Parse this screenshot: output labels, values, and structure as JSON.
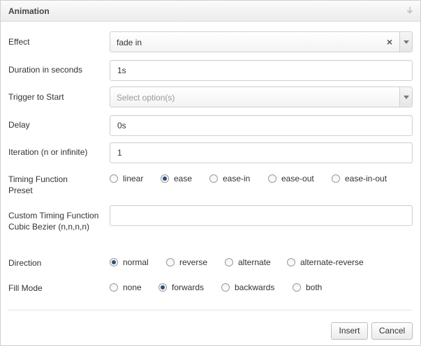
{
  "dialog": {
    "title": "Animation"
  },
  "fields": {
    "effect": {
      "label": "Effect",
      "value": "fade in",
      "clear_glyph": "×"
    },
    "duration": {
      "label": "Duration in seconds",
      "value": "1s"
    },
    "trigger": {
      "label": "Trigger to Start",
      "placeholder": "Select option(s)"
    },
    "delay": {
      "label": "Delay",
      "value": "0s"
    },
    "iteration": {
      "label": "Iteration (n or infinite)",
      "value": "1"
    },
    "timing_preset": {
      "label": "Timing Function Preset",
      "options": [
        "linear",
        "ease",
        "ease-in",
        "ease-out",
        "ease-in-out"
      ],
      "selected": "ease"
    },
    "custom_timing": {
      "label": "Custom Timing Function Cubic Bezier (n,n,n,n)",
      "value": ""
    },
    "direction": {
      "label": "Direction",
      "options": [
        "normal",
        "reverse",
        "alternate",
        "alternate-reverse"
      ],
      "selected": "normal"
    },
    "fill_mode": {
      "label": "Fill Mode",
      "options": [
        "none",
        "forwards",
        "backwards",
        "both"
      ],
      "selected": "forwards"
    }
  },
  "buttons": {
    "insert": "Insert",
    "cancel": "Cancel"
  },
  "colors": {
    "radio_checked": "#2a4f7a",
    "border": "#cfcfcf"
  }
}
